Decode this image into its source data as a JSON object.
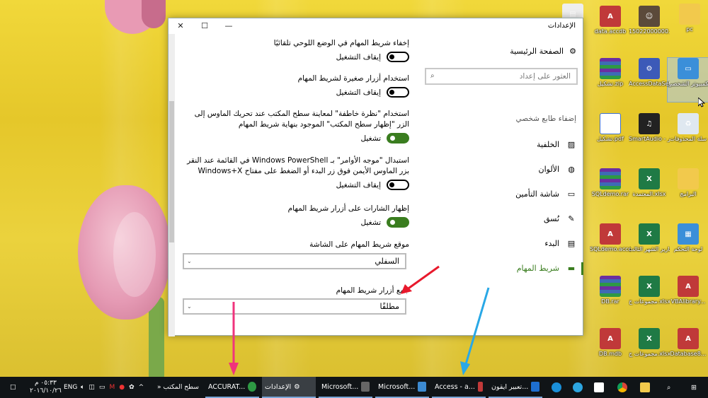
{
  "window": {
    "title": "الإعدادات",
    "min": "—",
    "max": "☐",
    "close": "✕"
  },
  "content": {
    "opt1": {
      "desc": "إخفاء شريط المهام في الوضع اللوحي تلقائيًا",
      "state": "إيقاف التشغيل"
    },
    "opt2": {
      "desc": "استخدام أزرار صغيرة لشريط المهام",
      "state": "إيقاف التشغيل"
    },
    "opt3": {
      "desc": "استخدام \"نظرة خاطفة\" لمعاينة سطح المكتب عند تحريك الماوس إلى الزر \"إظهار سطح المكتب\" الموجود بنهاية شريط المهام",
      "state": "تشغيل"
    },
    "opt4": {
      "desc": "استبدال \"موجه الأوامر\" بـ Windows PowerShell في القائمة عند النقر بزر الماوس الأيمن فوق زر البدء أو الضغط على مفتاح Windows+X",
      "state": "إيقاف التشغيل"
    },
    "opt5": {
      "desc": "إظهار الشارات على أزرار شريط المهام",
      "state": "تشغيل"
    },
    "location": {
      "label": "موقع شريط المهام على الشاشة",
      "value": "السفلي"
    },
    "combine": {
      "label": "جمع أزرار شريط المهام",
      "value": "مطلقًا"
    }
  },
  "sidenav": {
    "home": "الصفحة الرئيسية",
    "search_placeholder": "العثور على إعداد",
    "section": "إضفاء طابع شخصي",
    "items": [
      {
        "label": "الخلفية",
        "icon": "image-icon"
      },
      {
        "label": "الألوان",
        "icon": "palette-icon"
      },
      {
        "label": "شاشة التأمين",
        "icon": "lock-screen-icon"
      },
      {
        "label": "نُسق",
        "icon": "themes-icon"
      },
      {
        "label": "البدء",
        "icon": "start-icon"
      },
      {
        "label": "شريط المهام",
        "icon": "taskbar-icon"
      }
    ]
  },
  "desktop_icons": [
    {
      "label": "pc"
    },
    {
      "label": "15022000000..."
    },
    {
      "label": "data.accdb"
    },
    {
      "label": "هذا الكمبيوتر الشخصي"
    },
    {
      "label": "AccessDataSet..."
    },
    {
      "label": "تشكيل.zip"
    },
    {
      "label": "سلة المحذوفات"
    },
    {
      "label": "SmartAudio - اختصار"
    },
    {
      "label": "تشكيل.pdf"
    },
    {
      "label": "البرامج"
    },
    {
      "label": "المعتمدة.xlsx"
    },
    {
      "label": "SQLdemo.rar"
    },
    {
      "label": "لوحة التحكم"
    },
    {
      "label": "تقارير الشهر الثالث.xlsx"
    },
    {
      "label": "SQLdemo.accdb"
    },
    {
      "label": "VBAlibrary..."
    },
    {
      "label": "مجموعات ج.xlsx"
    },
    {
      "label": "DB.rar"
    },
    {
      "label": "Database8..."
    },
    {
      "label": "مجموعات ج.xlsx"
    },
    {
      "label": "DB.mdb"
    }
  ],
  "taskbar": {
    "items": [
      {
        "label": "ACCURAT..."
      },
      {
        "label": "الإعدادات"
      },
      {
        "label": "Microsoft..."
      },
      {
        "label": "Microsoft..."
      },
      {
        "label": "Access - a..."
      },
      {
        "label": "تعبير ايقون..."
      }
    ],
    "desktop_label": "سطح المكتب",
    "lang": "ENG",
    "time": "٠٥:٣٣ م",
    "date": "٢٠١٦/١٠/٢٦"
  },
  "colors": {
    "accent": "#3a7d1f",
    "arrow_red": "#e8192c",
    "arrow_pink": "#f0347c",
    "arrow_blue": "#29a8e6"
  }
}
